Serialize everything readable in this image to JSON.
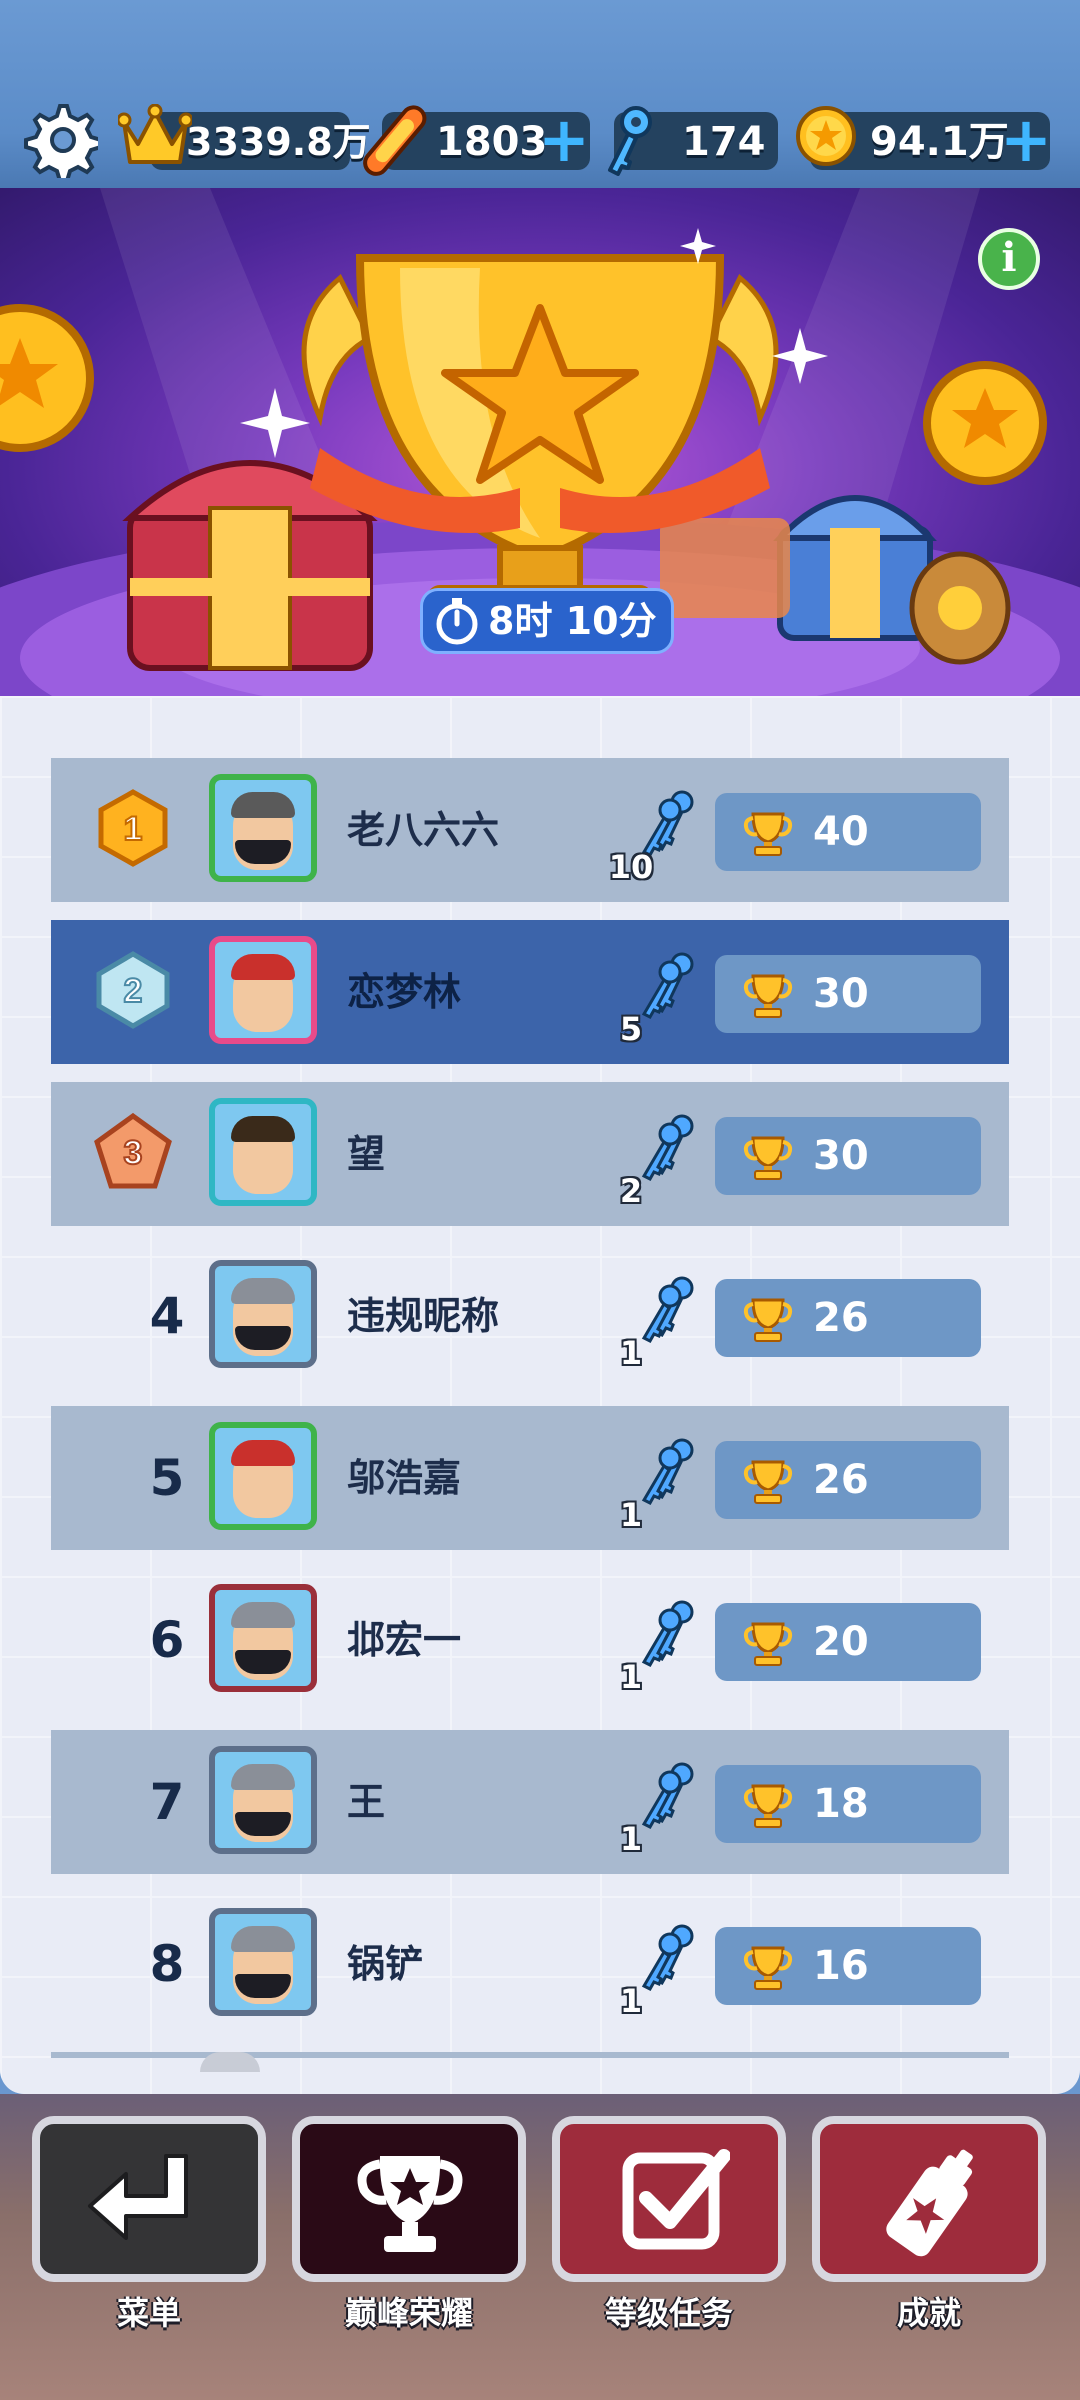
{
  "currency": {
    "crowns": "3339.8万",
    "boards": "1803",
    "keys": "174",
    "coins": "94.1万",
    "plus": "+"
  },
  "banner": {
    "timer": "8时 10分",
    "info": "i"
  },
  "leaderboard": [
    {
      "rank": "1",
      "name": "老八六六",
      "keys": "10",
      "score": "40",
      "medal": "gold"
    },
    {
      "rank": "2",
      "name": "恋梦林",
      "keys": "5",
      "score": "30",
      "medal": "silver"
    },
    {
      "rank": "3",
      "name": "望",
      "keys": "2",
      "score": "30",
      "medal": "bronze"
    },
    {
      "rank": "4",
      "name": "违规昵称",
      "keys": "1",
      "score": "26"
    },
    {
      "rank": "5",
      "name": "邬浩嘉",
      "keys": "1",
      "score": "26"
    },
    {
      "rank": "6",
      "name": "邶宏一",
      "keys": "1",
      "score": "20"
    },
    {
      "rank": "7",
      "name": "王",
      "keys": "1",
      "score": "18"
    },
    {
      "rank": "8",
      "name": "锅铲",
      "keys": "1",
      "score": "16"
    }
  ],
  "nav": {
    "menu": "菜单",
    "peak_honor": "巅峰荣耀",
    "level_tasks": "等级任务",
    "achievements": "成就"
  },
  "colors": {
    "highlight_row": "#3c64aa",
    "stripe_row": "#a8b9cf",
    "score_box": "#6e97c6"
  }
}
